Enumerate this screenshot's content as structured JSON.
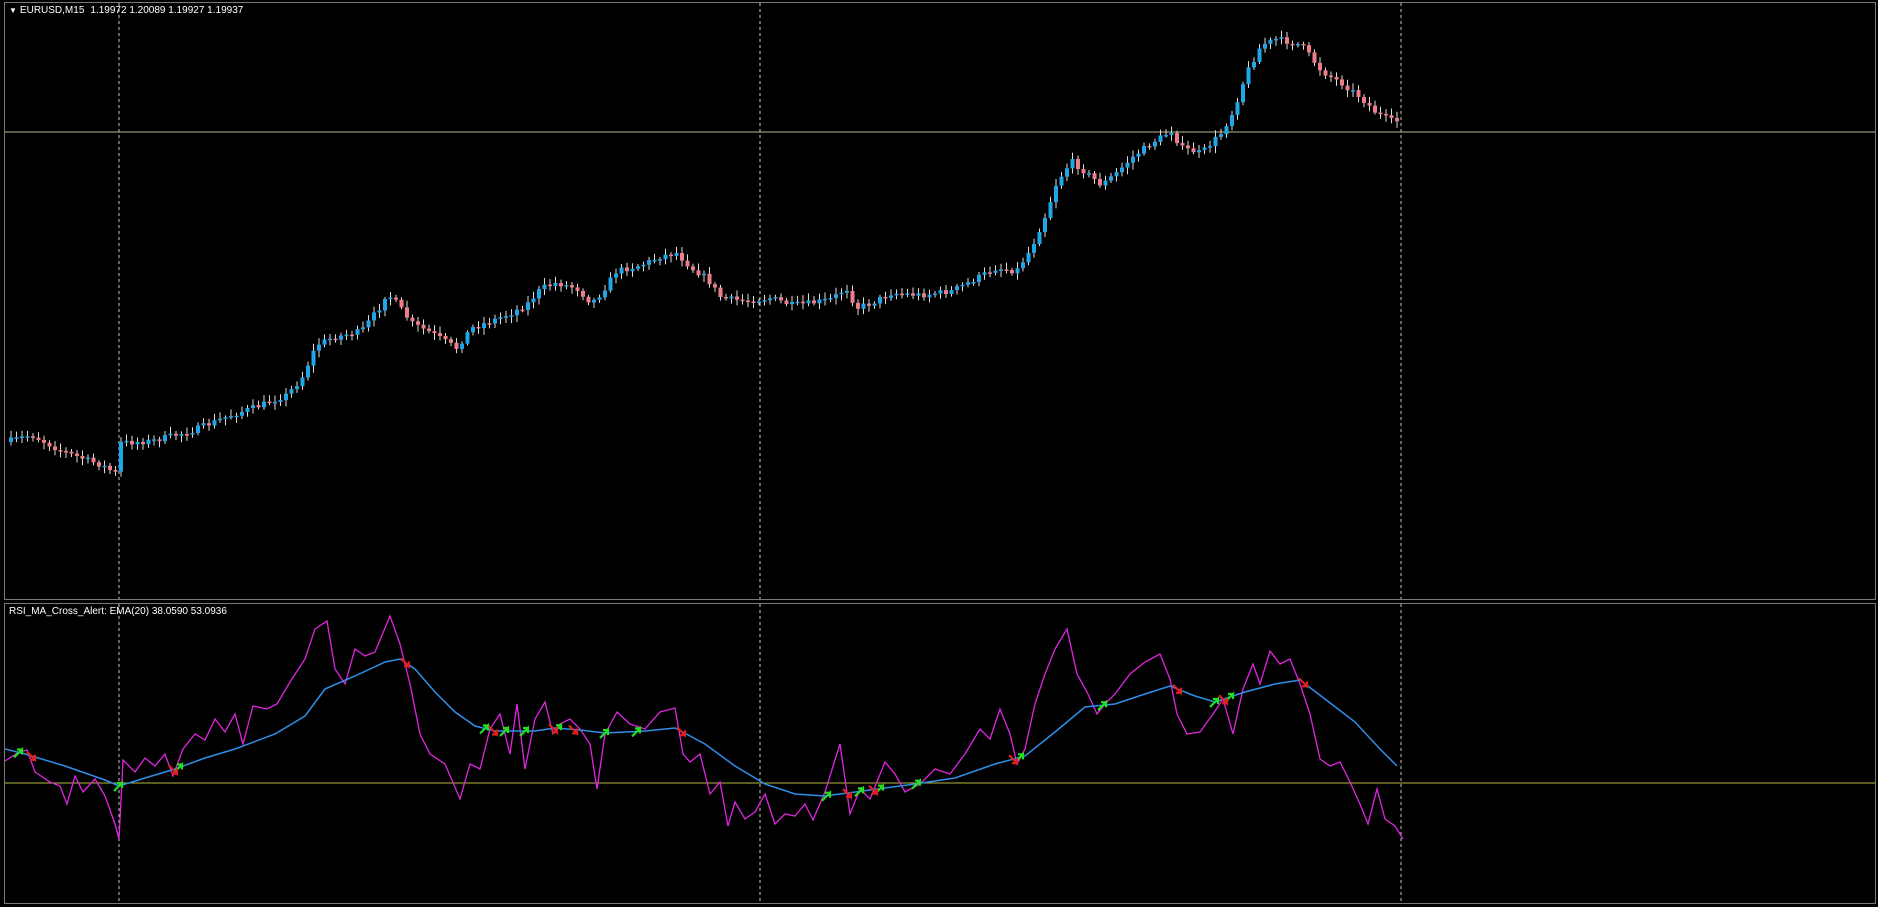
{
  "price_pane": {
    "symbol": "EURUSD,M15",
    "ohlc": "1.19972 1.20089 1.19927 1.19937",
    "collapse_icon": "triangle-down-icon",
    "colors": {
      "bull": "#1ea7e8",
      "bear": "#f07c8a",
      "grid": "#c8c8c8",
      "hline": "#b8b890",
      "background": "#000000",
      "frame": "#7a7a7a"
    }
  },
  "indicator_pane": {
    "name": "RSI_MA_Cross_Alert: EMA(20)",
    "values": "38.0590 53.0936",
    "colors": {
      "rsi": "#e026e0",
      "ema": "#2e8fe8",
      "level": "#b8b840",
      "buy_arrow": "#22e022",
      "sell_arrow": "#e02020"
    }
  }
}
